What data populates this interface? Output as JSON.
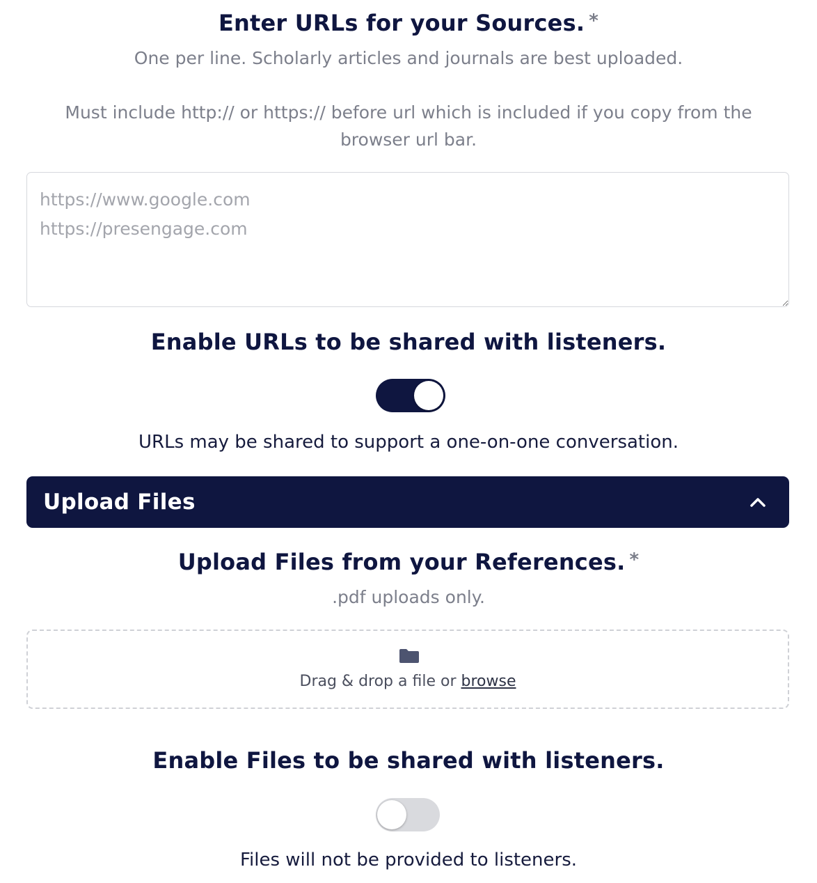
{
  "urls_section": {
    "title": "Enter URLs for your Sources.",
    "required_marker": "*",
    "subtitle": "One per line. Scholarly articles and journals are best uploaded.",
    "hint": "Must include http:// or https:// before url which is included if you copy from the browser url bar.",
    "textarea_value": "",
    "textarea_placeholder": "https://www.google.com\nhttps://presengage.com"
  },
  "urls_sharing": {
    "title": "Enable URLs to be shared with listeners.",
    "toggle_state": "on",
    "description": "URLs may be shared to support a one-on-one conversation."
  },
  "upload_panel": {
    "header_title": "Upload Files",
    "expanded": true,
    "chevron_icon": "chevron-up-icon",
    "title": "Upload Files from your References.",
    "required_marker": "*",
    "subtitle": ".pdf uploads only.",
    "dropzone": {
      "icon": "folder-icon",
      "text": "Drag & drop a file or",
      "browse_label": "browse"
    }
  },
  "files_sharing": {
    "title": "Enable Files to be shared with listeners.",
    "toggle_state": "off",
    "description": "Files will not be provided to listeners."
  },
  "colors": {
    "primary": "#0f1640",
    "muted_text": "#7c7f8b",
    "toggle_off": "#d9dade",
    "border": "#d6d8dd"
  }
}
